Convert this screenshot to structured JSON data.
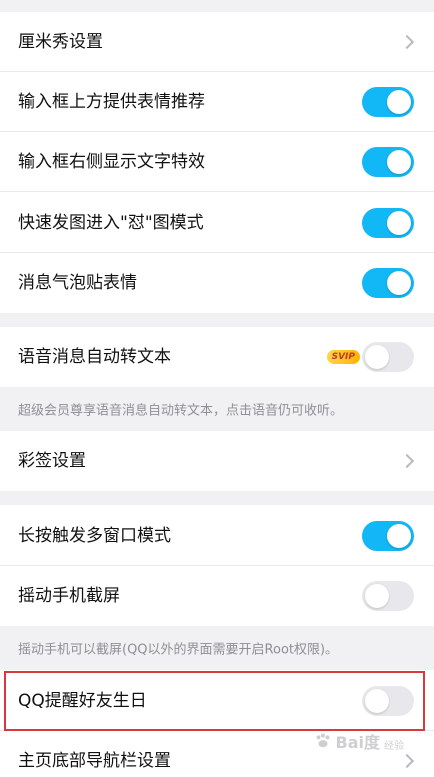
{
  "settings": {
    "items": [
      {
        "label": "厘米秀设置",
        "control": "chevron"
      },
      {
        "label": "输入框上方提供表情推荐",
        "control": "toggle",
        "state": "on"
      },
      {
        "label": "输入框右侧显示文字特效",
        "control": "toggle",
        "state": "on"
      },
      {
        "label": "快速发图进入\"怼\"图模式",
        "control": "toggle",
        "state": "on"
      },
      {
        "label": "消息气泡贴表情",
        "control": "toggle",
        "state": "on"
      },
      {
        "label": "语音消息自动转文本",
        "control": "toggle",
        "state": "off",
        "badge": "SVIP"
      },
      {
        "label": "彩签设置",
        "control": "chevron"
      },
      {
        "label": "长按触发多窗口模式",
        "control": "toggle",
        "state": "on"
      },
      {
        "label": "摇动手机截屏",
        "control": "toggle",
        "state": "off"
      },
      {
        "label": "QQ提醒好友生日",
        "control": "toggle",
        "state": "off"
      },
      {
        "label": "主页底部导航栏设置",
        "control": "chevron"
      }
    ],
    "notes": {
      "voice": "超级会员尊享语音消息自动转文本，点击语音仍可收听。",
      "shake": "摇动手机可以截屏(QQ以外的界面需要开启Root权限)。"
    }
  },
  "colors": {
    "toggle_on": "#12b7f5",
    "toggle_off": "#e8e8ec",
    "highlight_border": "#d83a3a",
    "background": "#f1f1f3"
  },
  "watermark": {
    "text": "Bai度",
    "sub": "经验"
  }
}
